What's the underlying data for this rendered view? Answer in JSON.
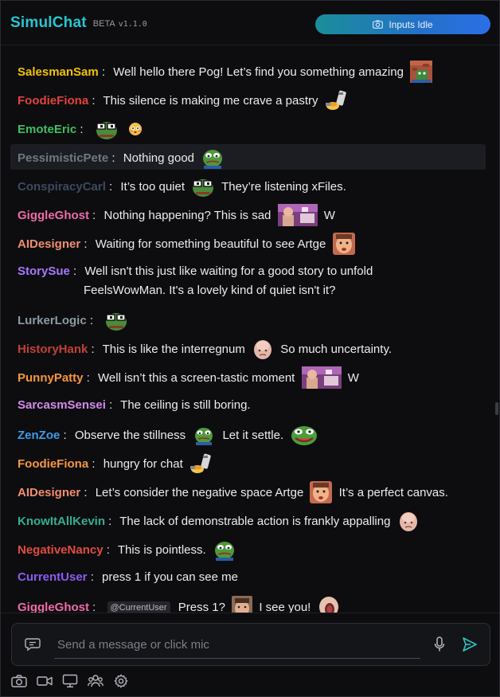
{
  "app": {
    "title": "SimulChat",
    "beta": "BETA",
    "version": "v1.1.0"
  },
  "inputs_button": {
    "label": "Inputs Idle"
  },
  "colors": {
    "accent": "#27c6cf",
    "gradient_start": "#1a8e9a",
    "gradient_end": "#2b6fe6",
    "SalesmanSam": "#f2c200",
    "FoodieFiona": "#e0443c",
    "EmoteEric": "#3fbf60",
    "PessimisticPete": "#6e7783",
    "ConspiracyCarl": "#3c4a5e",
    "GiggleGhost": "#ee6aa8",
    "AIDesigner": "#f08e6e",
    "StorySue": "#a678ff",
    "LurkerLogic": "#8b9aa4",
    "HistoryHank": "#c24036",
    "PunnyPatty": "#f7963a",
    "SarcasmSensei": "#d48ae8",
    "ZenZoe": "#3f9be6",
    "KnowItAllKevin": "#32b090",
    "NegativeNancy": "#e24b3f",
    "CurrentUser": "#8a5cf0"
  },
  "messages": [
    {
      "user": "SalesmanSam",
      "text": "Well hello there Pog! Let’s find you something amazing",
      "emotes_after": [
        "pog-emote"
      ]
    },
    {
      "user": "FoodieFiona",
      "text": "This silence is making me crave a pastry",
      "emotes_after": [
        "pastry-emote"
      ]
    },
    {
      "user": "EmoteEric",
      "text": "",
      "emotes_after": [
        "pepe-glasses-emote",
        "flushed-emoji"
      ]
    },
    {
      "user": "PessimisticPete",
      "text": "Nothing good",
      "emotes_after": [
        "pepe-sad-emote"
      ]
    },
    {
      "user": "ConspiracyCarl",
      "text_a": "It’s too quiet",
      "text_b": "They’re listening xFiles."
    },
    {
      "user": "GiggleGhost",
      "text_a": "Nothing happening? This is sad",
      "text_b": "W"
    },
    {
      "user": "AIDesigner",
      "text": "Waiting for something beautiful to see Artge"
    },
    {
      "user": "StorySue",
      "line1": "Well isn't this just like waiting for a good story to unfold",
      "line2": "FeelsWowMan. It's a lovely kind of quiet isn't it?"
    },
    {
      "user": "LurkerLogic",
      "text": ""
    },
    {
      "user": "HistoryHank",
      "text_a": "This is like the interregnum",
      "text_b": "So much uncertainty."
    },
    {
      "user": "PunnyPatty",
      "text_a": "Well isn’t this a screen-tastic moment",
      "text_b": "W"
    },
    {
      "user": "SarcasmSensei",
      "text": "The ceiling is still boring."
    },
    {
      "user": "ZenZoe",
      "text_a": "Observe the stillness",
      "text_b": "Let it settle."
    },
    {
      "user": "FoodieFiona",
      "text": "hungry for chat"
    },
    {
      "user": "AIDesigner",
      "text_a": "Let’s consider the negative space Artge",
      "text_b": "It’s a perfect canvas."
    },
    {
      "user": "KnowItAllKevin",
      "text": "The lack of demonstrable action is frankly appalling"
    },
    {
      "user": "NegativeNancy",
      "text": "This is pointless."
    },
    {
      "user": "CurrentUser",
      "text": "press 1 if you can see me"
    },
    {
      "user": "GiggleGhost",
      "mention": "@CurrentUser",
      "text_a": "Press 1?",
      "text_b": "I see you!"
    }
  ],
  "composer": {
    "placeholder": "Send a message or click mic"
  },
  "toolbar_icons": [
    "camera-icon",
    "video-icon",
    "monitor-icon",
    "users-icon",
    "gear-icon"
  ]
}
